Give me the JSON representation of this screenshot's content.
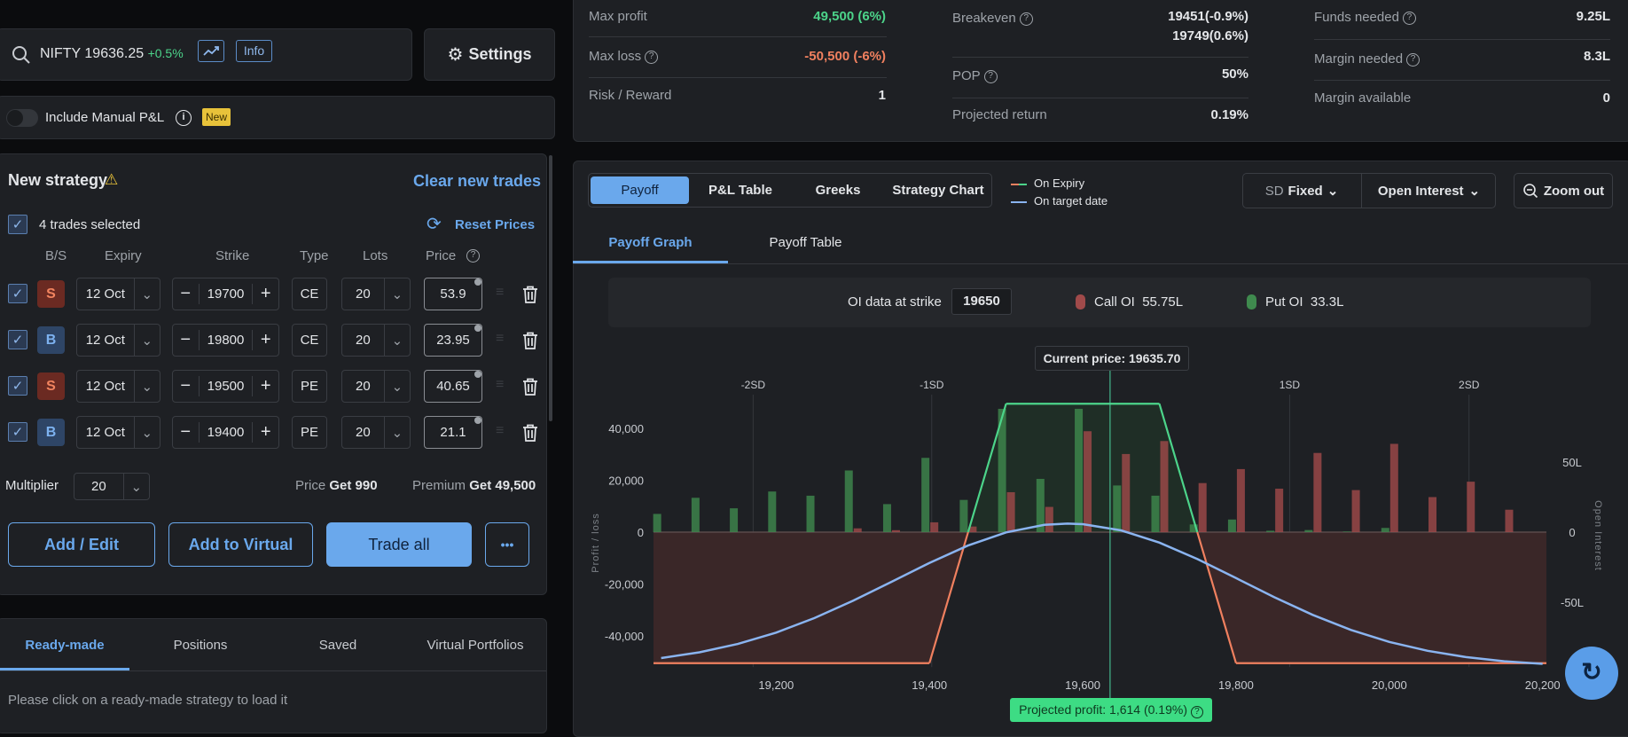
{
  "search": {
    "symbol": "NIFTY",
    "price": "19636.25",
    "change": "+0.5%",
    "info_label": "Info"
  },
  "settings_label": "Settings",
  "manual_pl": {
    "label": "Include Manual P&L",
    "badge": "New",
    "enabled": false
  },
  "strategy": {
    "title": "New strategy",
    "clear_label": "Clear new trades",
    "selected_label": "4 trades selected",
    "reset_label": "Reset Prices",
    "headers": {
      "bs": "B/S",
      "expiry": "Expiry",
      "strike": "Strike",
      "type": "Type",
      "lots": "Lots",
      "price": "Price"
    },
    "trades": [
      {
        "side": "S",
        "expiry": "12 Oct",
        "strike": "19700",
        "type": "CE",
        "lots": "20",
        "price": "53.9"
      },
      {
        "side": "B",
        "expiry": "12 Oct",
        "strike": "19800",
        "type": "CE",
        "lots": "20",
        "price": "23.95"
      },
      {
        "side": "S",
        "expiry": "12 Oct",
        "strike": "19500",
        "type": "PE",
        "lots": "20",
        "price": "40.65"
      },
      {
        "side": "B",
        "expiry": "12 Oct",
        "strike": "19400",
        "type": "PE",
        "lots": "20",
        "price": "21.1"
      }
    ],
    "multiplier_label": "Multiplier",
    "multiplier": "20",
    "price_label": "Price",
    "price_value": "Get 990",
    "premium_label": "Premium",
    "premium_value": "Get 49,500",
    "buttons": {
      "add_edit": "Add / Edit",
      "add_virtual": "Add to Virtual",
      "trade_all": "Trade all",
      "more": "•••"
    }
  },
  "bottom_tabs": {
    "tabs": [
      "Ready-made",
      "Positions",
      "Saved",
      "Virtual Portfolios"
    ],
    "active": 0,
    "message": "Please click on a ready-made strategy to load it"
  },
  "stats": {
    "max_profit": {
      "label": "Max profit",
      "value": "49,500 (6%)"
    },
    "max_loss": {
      "label": "Max loss",
      "value": "-50,500 (-6%)"
    },
    "risk_reward": {
      "label": "Risk / Reward",
      "value": "1"
    },
    "breakeven": {
      "label": "Breakeven",
      "values": [
        "19451(-0.9%)",
        "19749(0.6%)"
      ]
    },
    "pop": {
      "label": "POP",
      "value": "50%"
    },
    "projected_return": {
      "label": "Projected return",
      "value": "0.19%"
    },
    "funds_needed": {
      "label": "Funds needed",
      "value": "9.25L"
    },
    "margin_needed": {
      "label": "Margin needed",
      "value": "8.3L"
    },
    "margin_available": {
      "label": "Margin available",
      "value": "0"
    }
  },
  "chart_tabs": {
    "tabs": [
      "Payoff",
      "P&L Table",
      "Greeks",
      "Strategy Chart"
    ],
    "active": 0
  },
  "legend": {
    "expiry": "On Expiry",
    "target": "On target date"
  },
  "controls": {
    "sd_label": "SD",
    "sd_value": "Fixed",
    "oi_label": "Open Interest",
    "zoom_label": "Zoom out"
  },
  "sub_tabs": {
    "tabs": [
      "Payoff Graph",
      "Payoff Table"
    ],
    "active": 0
  },
  "oi_strip": {
    "label": "OI data at strike",
    "strike": "19650",
    "call_label": "Call OI",
    "call_value": "55.75L",
    "put_label": "Put OI",
    "put_value": "33.3L"
  },
  "current_price_label": "Current price: 19635.70",
  "projected_profit_label": "Projected profit: 1,614 (0.19%)",
  "colors": {
    "accent": "#6aa8ec",
    "profit": "#4cd48a",
    "loss": "#f0805f",
    "call_oi": "#a04a4a",
    "put_oi": "#3f8a4e",
    "target": "#8ab4f0"
  },
  "chart_data": {
    "type": "line",
    "xlabel": "",
    "ylabel": "Profit / loss",
    "y2label": "Open Interest",
    "xlim": [
      19040,
      20205
    ],
    "ylim": [
      -52000,
      53000
    ],
    "xticks": [
      "19,200",
      "19,400",
      "19,600",
      "19,800",
      "20,000",
      "20,200"
    ],
    "xtick_values": [
      19200,
      19400,
      19600,
      19800,
      20000,
      20200
    ],
    "yticks": [
      "40,000",
      "20,000",
      "0",
      "-20,000",
      "-40,000"
    ],
    "ytick_values": [
      40000,
      20000,
      0,
      -20000,
      -40000
    ],
    "y2ticks": [
      "50L",
      "0",
      "-50L"
    ],
    "y2tick_values": [
      50,
      0,
      -50
    ],
    "sd_lines": [
      {
        "label": "-2SD",
        "x": 19170
      },
      {
        "label": "-1SD",
        "x": 19403
      },
      {
        "label": "1SD",
        "x": 19870
      },
      {
        "label": "2SD",
        "x": 20104
      }
    ],
    "current_price": 19635.7,
    "series": [
      {
        "name": "On Expiry",
        "points": [
          [
            19040,
            -50500
          ],
          [
            19400,
            -50500
          ],
          [
            19500,
            49500
          ],
          [
            19700,
            49500
          ],
          [
            19800,
            -50500
          ],
          [
            20205,
            -50500
          ]
        ]
      },
      {
        "name": "On target date",
        "points": [
          [
            19050,
            -48550
          ],
          [
            19100,
            -46320
          ],
          [
            19150,
            -43100
          ],
          [
            19200,
            -38720
          ],
          [
            19250,
            -33140
          ],
          [
            19300,
            -26510
          ],
          [
            19350,
            -19210
          ],
          [
            19400,
            -11860
          ],
          [
            19450,
            -5210
          ],
          [
            19500,
            -105
          ],
          [
            19550,
            2790
          ],
          [
            19580,
            3284
          ],
          [
            19600,
            3070
          ],
          [
            19650,
            675
          ],
          [
            19700,
            -4050
          ],
          [
            19750,
            -10440
          ],
          [
            19800,
            -17720
          ],
          [
            19850,
            -25090
          ],
          [
            19900,
            -31890
          ],
          [
            19950,
            -37700
          ],
          [
            20000,
            -42320
          ],
          [
            20050,
            -45760
          ],
          [
            20100,
            -48170
          ],
          [
            20150,
            -49770
          ],
          [
            20200,
            -50760
          ]
        ]
      }
    ],
    "oi": {
      "strikes": [
        19050,
        19100,
        19150,
        19200,
        19250,
        19300,
        19350,
        19400,
        19450,
        19500,
        19550,
        19600,
        19650,
        19700,
        19750,
        19800,
        19850,
        19900,
        19950,
        20000,
        20050,
        20100,
        20150
      ],
      "put_oi_lakh": [
        13,
        24.5,
        17,
        29,
        26,
        44,
        20,
        53,
        23,
        88,
        38,
        88,
        33.3,
        26,
        5.5,
        9,
        1,
        1.5,
        0.4,
        3,
        0,
        0,
        0
      ],
      "call_oi_lakh": [
        0,
        0,
        0,
        0,
        0,
        2.7,
        1.4,
        7,
        4,
        28.5,
        18,
        72,
        55.75,
        65,
        35,
        45,
        31,
        56.5,
        30,
        63,
        25,
        36,
        16
      ]
    }
  }
}
